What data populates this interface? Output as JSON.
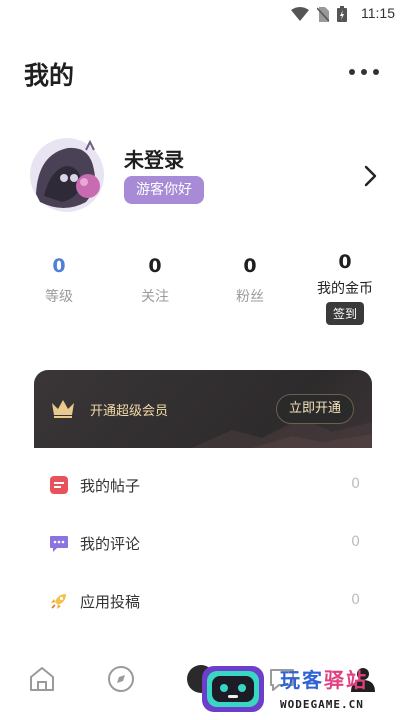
{
  "status_bar": {
    "time": "11:15"
  },
  "page": {
    "title": "我的"
  },
  "profile": {
    "username": "未登录",
    "badge": "游客你好"
  },
  "stats": [
    {
      "value": "0",
      "label": "等级"
    },
    {
      "value": "0",
      "label": "关注"
    },
    {
      "value": "0",
      "label": "粉丝"
    },
    {
      "value": "0",
      "label": "我的金币",
      "action": "签到"
    }
  ],
  "vip": {
    "text": "开通超级会员",
    "button": "立即开通"
  },
  "menu": [
    {
      "label": "我的帖子",
      "count": "0",
      "icon": "post-icon",
      "color": "#e8525b"
    },
    {
      "label": "我的评论",
      "count": "0",
      "icon": "comment-icon",
      "color": "#8a74e0"
    },
    {
      "label": "应用投稿",
      "count": "0",
      "icon": "rocket-icon",
      "color": "#f0a030"
    }
  ],
  "bottom_nav": [
    {
      "icon": "home-icon"
    },
    {
      "icon": "compass-icon"
    },
    {
      "icon": "center-icon"
    },
    {
      "icon": "message-icon"
    },
    {
      "icon": "profile-icon"
    }
  ],
  "watermark": {
    "title_a": "玩客",
    "title_b": "驿站",
    "url": "WODEGAME.CN"
  },
  "colors": {
    "accent_blue": "#4f7fd6",
    "badge_purple": "#a78bd6",
    "vip_gold": "#efd9a6"
  }
}
